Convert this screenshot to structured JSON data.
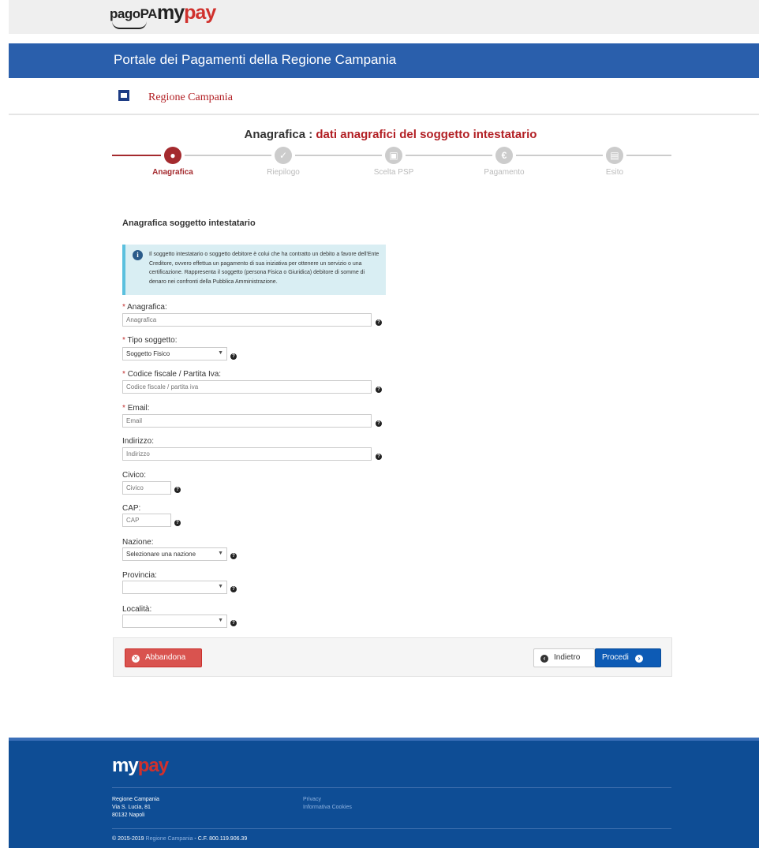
{
  "header": {
    "pagopa_logo": "pagoPA",
    "mypay_logo_m": "my",
    "mypay_logo_p": "pay",
    "portal_title": "Portale dei Pagamenti della Regione Campania",
    "region_name": "Regione Campania"
  },
  "heading": {
    "main": "Anagrafica : ",
    "sub": "dati anagrafici del soggetto intestatario"
  },
  "steps": [
    {
      "label": "Anagrafica",
      "icon": "user-icon",
      "active": true
    },
    {
      "label": "Riepilogo",
      "icon": "check-icon",
      "active": false
    },
    {
      "label": "Scelta PSP",
      "icon": "bank-icon",
      "active": false
    },
    {
      "label": "Pagamento",
      "icon": "euro-icon",
      "active": false
    },
    {
      "label": "Esito",
      "icon": "document-icon",
      "active": false
    }
  ],
  "form": {
    "section_title": "Anagrafica soggetto intestatario",
    "info_text": "Il soggetto intestatario o soggetto debitore è colui che ha contratto un debito a favore dell'Ente Creditore, ovvero effettua un pagamento di sua iniziativa per ottenere un servizio o una certificazione. Rappresenta il soggetto (persona Fisica o Giuridica) debitore di somme di denaro nei confronti della Pubblica Amministrazione.",
    "required_mark": "*",
    "anagrafica": {
      "label": "Anagrafica:",
      "placeholder": "Anagrafica"
    },
    "tipo_soggetto": {
      "label": "Tipo soggetto:",
      "value": "Soggetto Fisico"
    },
    "codice_fiscale": {
      "label": "Codice fiscale / Partita Iva:",
      "placeholder": "Codice fiscale / partita iva"
    },
    "email": {
      "label": "Email:",
      "placeholder": "Email"
    },
    "indirizzo": {
      "label": "Indirizzo:",
      "placeholder": "Indirizzo"
    },
    "civico": {
      "label": "Civico:",
      "placeholder": "Civico"
    },
    "cap": {
      "label": "CAP:",
      "placeholder": "CAP"
    },
    "nazione": {
      "label": "Nazione:",
      "value": "Selezionare una nazione"
    },
    "provincia": {
      "label": "Provincia:",
      "value": ""
    },
    "localita": {
      "label": "Località:",
      "value": ""
    }
  },
  "actions": {
    "abbandona": "Abbandona",
    "indietro": "Indietro",
    "procedi": "Procedi"
  },
  "footer": {
    "logo_m": "my",
    "logo_p": "pay",
    "address_line1": "Regione Campania",
    "address_line2": "Via S. Lucia, 81",
    "address_line3": "80132 Napoli",
    "link_privacy": "Privacy",
    "link_cookies": "Informativa Cookies",
    "copyright_prefix": "© 2015-2019 ",
    "copyright_link": "Regione Campania",
    "copyright_suffix": " - C.F. 800.119.906.39"
  },
  "colors": {
    "brand_blue": "#2a5fac",
    "accent_red": "#a42a2e",
    "footer_blue": "#0e4d95",
    "danger": "#d9534f",
    "primary": "#0d5bb5"
  }
}
